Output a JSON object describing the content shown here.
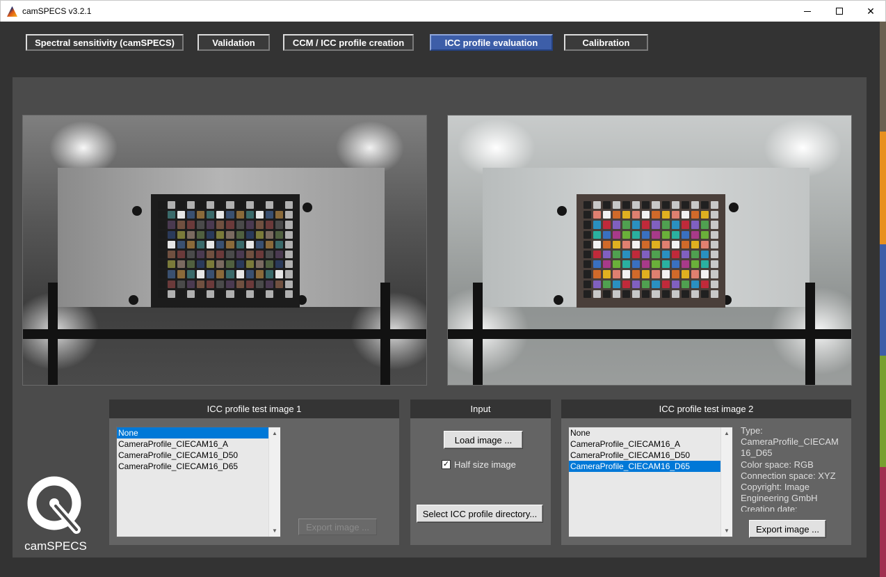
{
  "window": {
    "title": "camSPECS v3.2.1",
    "minimize_glyph": "—",
    "close_glyph": "✕"
  },
  "tabs": [
    {
      "label": "Spectral sensitivity (camSPECS)",
      "active": false
    },
    {
      "label": "Validation",
      "active": false
    },
    {
      "label": "CCM / ICC profile creation",
      "active": false
    },
    {
      "label": "ICC profile evaluation",
      "active": true
    },
    {
      "label": "Calibration",
      "active": false
    }
  ],
  "panel1": {
    "title": "ICC profile test image 1",
    "items": [
      "None",
      "CameraProfile_CIECAM16_A",
      "CameraProfile_CIECAM16_D50",
      "CameraProfile_CIECAM16_D65"
    ],
    "selected_index": 0,
    "export_label": "Export image ..."
  },
  "input_panel": {
    "title": "Input",
    "load_label": "Load image ...",
    "half_size_label": "Half size image",
    "half_size_checked": true,
    "check_glyph": "✓",
    "select_dir_label": "Select ICC profile directory..."
  },
  "panel2": {
    "title": "ICC profile test image 2",
    "items": [
      "None",
      "CameraProfile_CIECAM16_A",
      "CameraProfile_CIECAM16_D50",
      "CameraProfile_CIECAM16_D65"
    ],
    "selected_index": 3,
    "info_lines": [
      "Type:",
      "CameraProfile_CIECAM",
      "16_D65",
      "Color space: RGB",
      "Connection space: XYZ",
      "Copyright: Image",
      "Engineering GmbH",
      "Creation date:"
    ],
    "export_label": "Export image ..."
  },
  "scroll": {
    "up_glyph": "▲",
    "down_glyph": "▼"
  },
  "logo": {
    "text": "camSPECS"
  },
  "colors": {
    "background": "#333333",
    "panel": "#646464",
    "accent_tab": "#3d5ea8",
    "selection": "#0078d7",
    "stripe": [
      "#6a6050",
      "#e8901e",
      "#3d5ea8",
      "#78a030",
      "#a03050"
    ]
  }
}
